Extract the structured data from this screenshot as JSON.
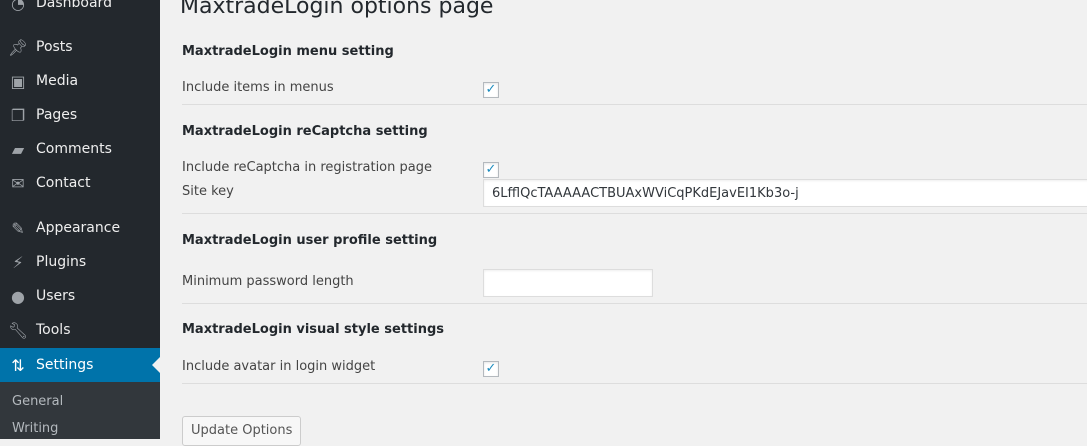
{
  "sidebar": {
    "items": [
      {
        "label": "Dashboard",
        "icon": "dashboard-icon"
      },
      {
        "label": "Posts",
        "icon": "pin-icon"
      },
      {
        "label": "Media",
        "icon": "media-icon"
      },
      {
        "label": "Pages",
        "icon": "pages-icon"
      },
      {
        "label": "Comments",
        "icon": "comment-icon"
      },
      {
        "label": "Contact",
        "icon": "mail-icon"
      },
      {
        "label": "Appearance",
        "icon": "brush-icon"
      },
      {
        "label": "Plugins",
        "icon": "plug-icon"
      },
      {
        "label": "Users",
        "icon": "user-icon"
      },
      {
        "label": "Tools",
        "icon": "wrench-icon"
      },
      {
        "label": "Settings",
        "icon": "settings-icon"
      }
    ],
    "submenu": [
      "General",
      "Writing"
    ]
  },
  "main": {
    "title": "MaxtradeLogin options page",
    "sections": [
      {
        "heading": "MaxtradeLogin menu setting",
        "include_items_label": "Include items in menus",
        "include_items_checked": true
      },
      {
        "heading": "MaxtradeLogin reCaptcha setting",
        "include_recaptcha_label": "Include reCaptcha in registration page",
        "include_recaptcha_checked": true,
        "site_key_label": "Site key",
        "site_key_value": "6LfflQcTAAAAACTBUAxWViCqPKdEJavEI1Kb3o-j"
      },
      {
        "heading": "MaxtradeLogin user profile setting",
        "min_password_label": "Minimum password length",
        "min_password_value": ""
      },
      {
        "heading": "MaxtradeLogin visual style settings",
        "include_avatar_label": "Include avatar in login widget",
        "include_avatar_checked": true
      }
    ],
    "update_button": "Update Options"
  },
  "colors": {
    "sidebar": "#23282d",
    "active": "#0073aa",
    "background": "#f1f1f1"
  }
}
